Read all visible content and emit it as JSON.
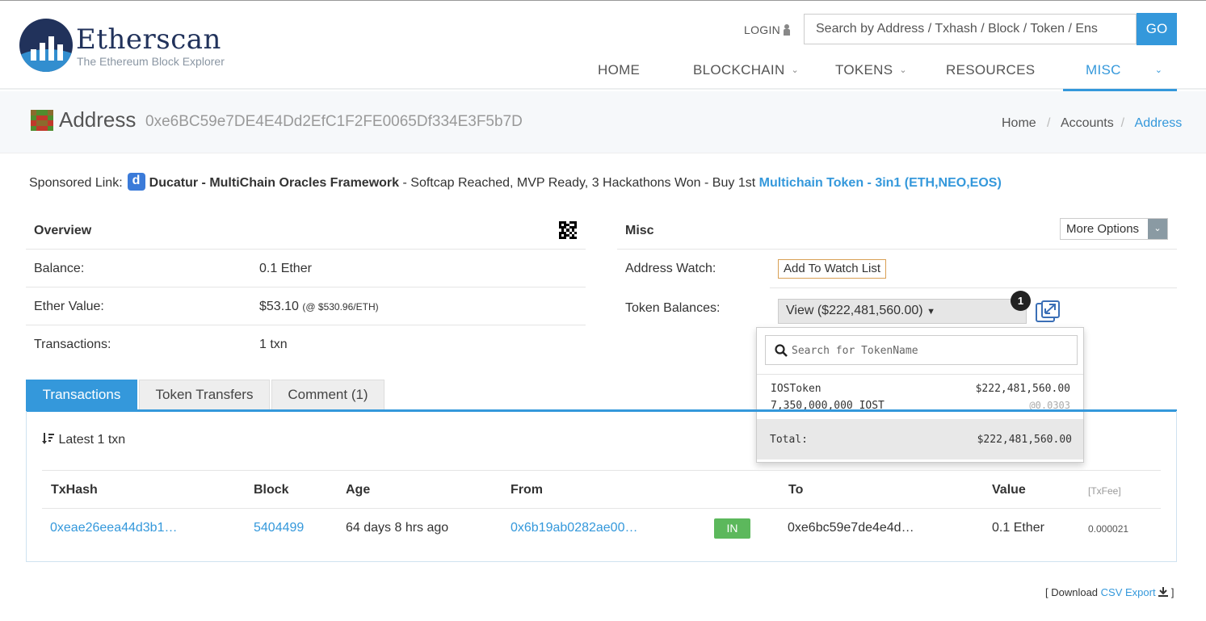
{
  "header": {
    "logo_title": "Etherscan",
    "logo_subtitle": "The Ethereum Block Explorer",
    "login": "LOGIN",
    "search_placeholder": "Search by Address / Txhash / Block / Token / Ens",
    "go_label": "GO",
    "nav": [
      "HOME",
      "BLOCKCHAIN",
      "TOKENS",
      "RESOURCES",
      "MISC"
    ],
    "active_nav": "MISC"
  },
  "page": {
    "title": "Address",
    "address": "0xe6BC59e7DE4E4Dd2EfC1F2FE0065Df334E3F5b7D",
    "breadcrumb": [
      "Home",
      "Accounts",
      "Address"
    ]
  },
  "sponsored": {
    "prefix": "Sponsored Link:",
    "name": "Ducatur - MultiChain Oracles Framework",
    "text": " - Softcap Reached, MVP Ready, 3 Hackathons Won - Buy 1st ",
    "link": "Multichain Token - 3in1 (ETH,NEO,EOS)"
  },
  "overview": {
    "heading": "Overview",
    "balance_label": "Balance:",
    "balance_value": "0.1 Ether",
    "ether_value_label": "Ether Value:",
    "ether_value": "$53.10",
    "ether_rate": "(@ $530.96/ETH)",
    "transactions_label": "Transactions:",
    "transactions_value": "1 txn"
  },
  "misc": {
    "heading": "Misc",
    "more_options": "More Options",
    "address_watch_label": "Address Watch:",
    "watch_button": "Add To Watch List",
    "token_balances_label": "Token Balances:",
    "view_button": "View ($222,481,560.00)",
    "badge_count": "1"
  },
  "token_dropdown": {
    "search_placeholder": "Search for TokenName",
    "token_name": "IOSToken",
    "token_value": "$222,481,560.00",
    "token_amount": "7,350,000,000 IOST",
    "token_rate": "@0.0303",
    "total_label": "Total:",
    "total_value": "$222,481,560.00"
  },
  "tabs": [
    "Transactions",
    "Token Transfers",
    "Comment (1)"
  ],
  "transactions": {
    "latest": "Latest 1 txn",
    "columns": [
      "TxHash",
      "Block",
      "Age",
      "From",
      "To",
      "Value",
      "[TxFee]"
    ],
    "rows": [
      {
        "txhash": "0xeae26eea44d3b1…",
        "block": "5404499",
        "age": "64 days 8 hrs ago",
        "from": "0x6b19ab0282ae00…",
        "direction": "IN",
        "to": "0xe6bc59e7de4e4d…",
        "value": "0.1 Ether",
        "txfee": "0.000021"
      }
    ]
  },
  "footer": {
    "download_prefix": "[ Download ",
    "csv_export": "CSV Export",
    "download_suffix": " ]"
  },
  "colors": {
    "accent": "#3498db",
    "navy": "#21325b",
    "in_badge": "#5cb85c"
  }
}
